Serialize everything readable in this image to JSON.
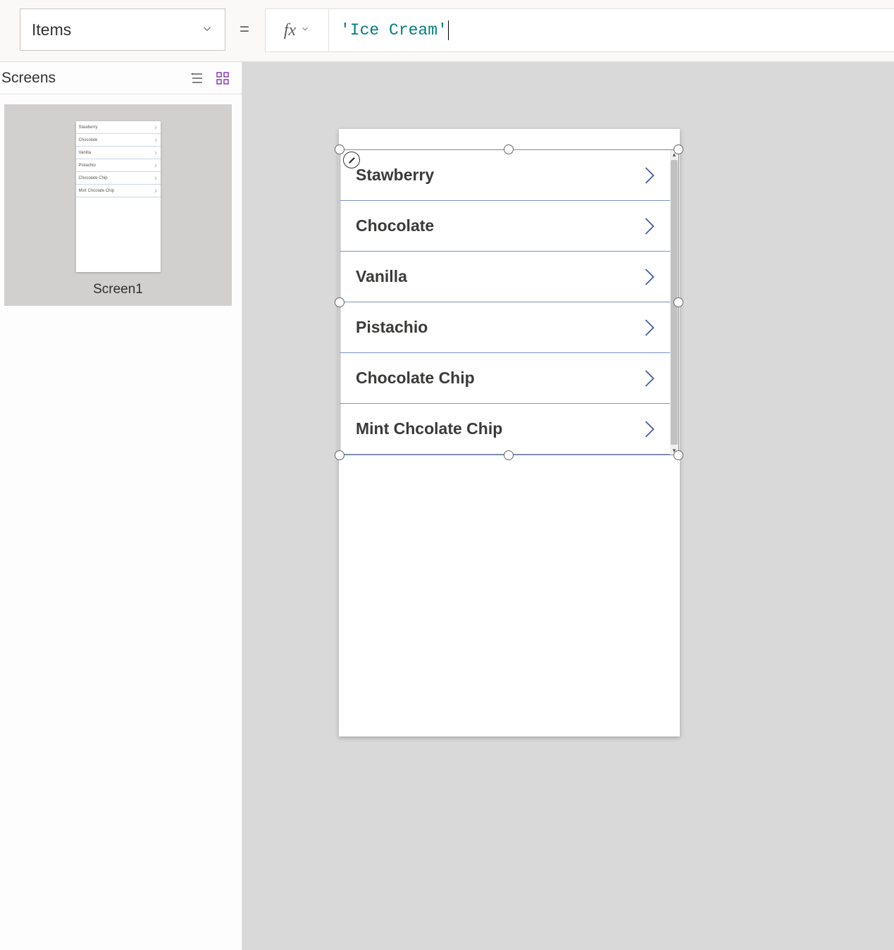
{
  "formula_bar": {
    "property": "Items",
    "formula": "'Ice Cream'"
  },
  "sidebar": {
    "title": "Screens",
    "screen_name": "Screen1"
  },
  "gallery": {
    "items": [
      {
        "label": "Stawberry"
      },
      {
        "label": "Chocolate"
      },
      {
        "label": "Vanilla"
      },
      {
        "label": "Pistachio"
      },
      {
        "label": "Chocolate Chip"
      },
      {
        "label": "Mint Chcolate Chip"
      }
    ]
  }
}
